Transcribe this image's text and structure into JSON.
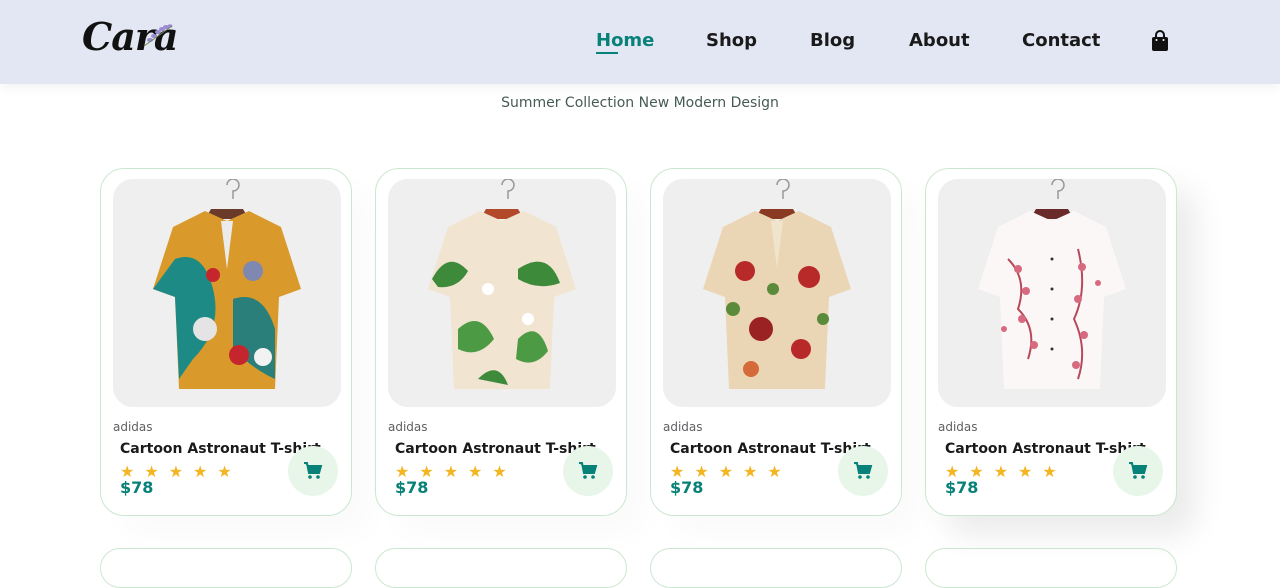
{
  "brand": {
    "logo_text": "Cara"
  },
  "nav": {
    "items": [
      "Home",
      "Shop",
      "Blog",
      "About",
      "Contact"
    ],
    "active": "Home"
  },
  "section": {
    "subtitle": "Summer Collection New Modern Design"
  },
  "products": [
    {
      "brand": "adidas",
      "name": "Cartoon Astronaut T-shirt",
      "stars": "★★★★★",
      "rating": 5,
      "price": "$78",
      "image_desc": "colorful abstract print shirt"
    },
    {
      "brand": "adidas",
      "name": "Cartoon Astronaut T-shirt",
      "stars": "★★★★★",
      "rating": 5,
      "price": "$78",
      "image_desc": "green leaf floral shirt"
    },
    {
      "brand": "adidas",
      "name": "Cartoon Astronaut T-shirt",
      "stars": "★★★★★",
      "rating": 5,
      "price": "$78",
      "image_desc": "cream red floral shirt"
    },
    {
      "brand": "adidas",
      "name": "Cartoon Astronaut T-shirt",
      "stars": "★★★★★",
      "rating": 5,
      "price": "$78",
      "image_desc": "white pink blossom shirt"
    }
  ],
  "icons": {
    "nav_cart": "shopping-bag-icon",
    "product_cart": "cart-icon",
    "star": "star-icon"
  },
  "colors": {
    "header_bg": "#e3e6f3",
    "accent": "#088178",
    "star": "#f3b521",
    "cart_bg": "#e8f6ea",
    "card_border": "#cce7d0"
  }
}
